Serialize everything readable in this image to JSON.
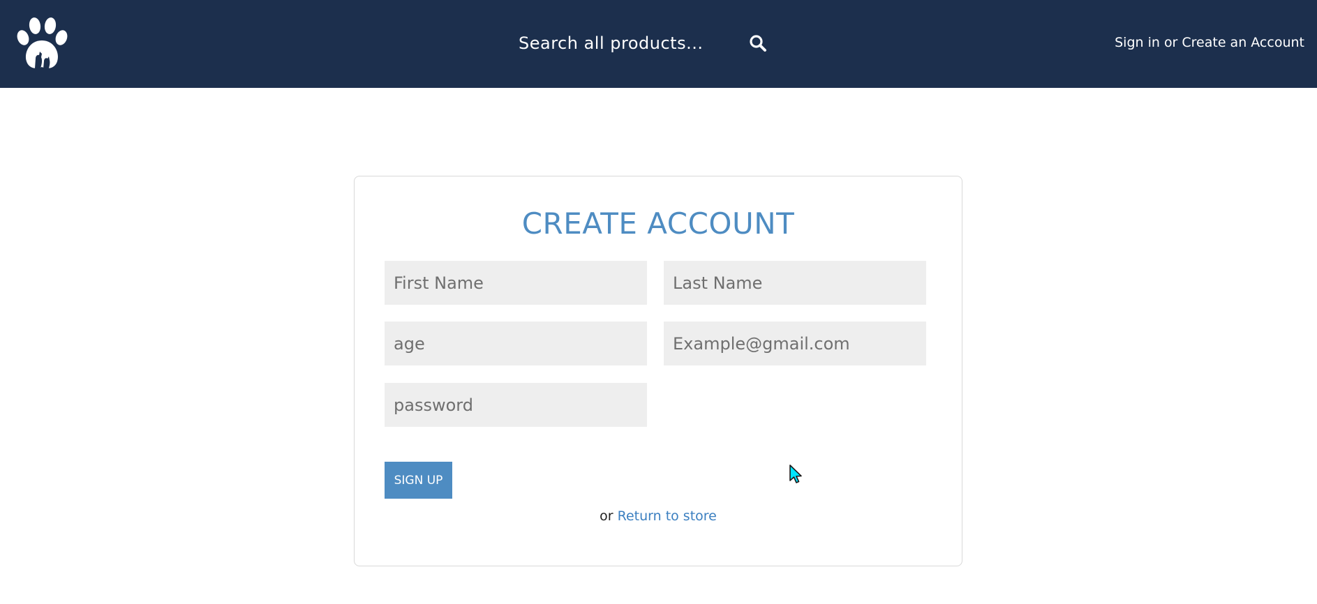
{
  "header": {
    "logo_icon": "paw-logo-icon",
    "search_placeholder": "Search all products...",
    "search_icon": "search-icon",
    "sign_in_label": "Sign in",
    "separator": "or",
    "create_account_label": "Create an Account",
    "background_color": "#1c2f4d"
  },
  "form": {
    "title": "CREATE ACCOUNT",
    "first_name_placeholder": "First Name",
    "last_name_placeholder": "Last Name",
    "age_placeholder": "age",
    "email_placeholder": "Example@gmail.com",
    "password_placeholder": "password",
    "signup_label": "SIGN UP",
    "return_prefix": "or",
    "return_link_label": "Return to store",
    "accent_color": "#4e8cc2"
  },
  "cursor": {
    "icon": "mouse-pointer-icon",
    "color": "#00e5ff"
  }
}
